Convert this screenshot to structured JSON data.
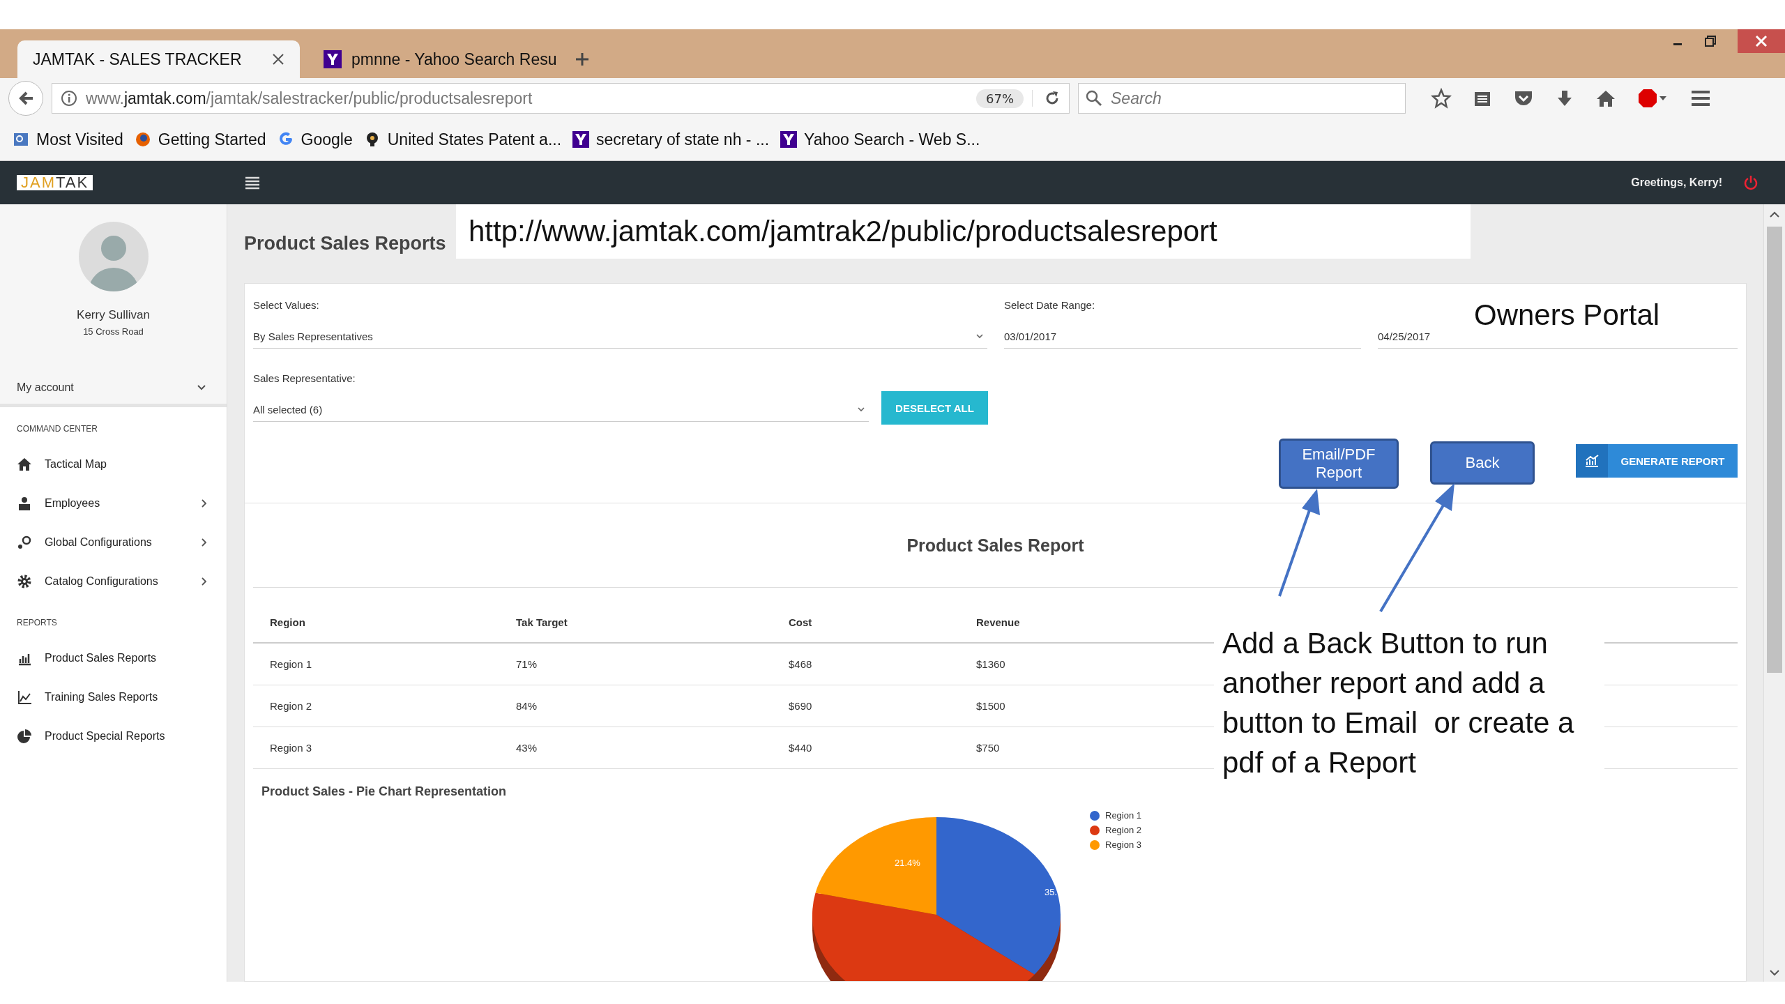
{
  "browser": {
    "tabs": [
      {
        "title": "JAMTAK - SALES TRACKER",
        "selected": true,
        "kind": "site"
      },
      {
        "title": "pmnne - Yahoo Search Resu",
        "selected": false,
        "kind": "yahoo"
      }
    ],
    "address": {
      "prefix": "www.",
      "domain": "jamtak.com",
      "path": "/jamtak/salestracker/public/productsalesreport"
    },
    "zoom": "67%",
    "search": {
      "placeholder": "Search"
    },
    "bookmarks": [
      {
        "label": "Most Visited",
        "kind": "folder"
      },
      {
        "label": "Getting Started",
        "kind": "firefox"
      },
      {
        "label": "Google",
        "kind": "google"
      },
      {
        "label": "United States Patent a...",
        "kind": "bulb"
      },
      {
        "label": "secretary of state nh - ...",
        "kind": "yahoo"
      },
      {
        "label": "Yahoo Search - Web S...",
        "kind": "yahoo"
      }
    ]
  },
  "app": {
    "logo": {
      "first": "JAM",
      "second": "TAK"
    },
    "greeting": "Greetings, Kerry!"
  },
  "sidebar": {
    "user": {
      "name": "Kerry Sullivan",
      "address": "15 Cross Road"
    },
    "account": "My account",
    "sections": [
      {
        "heading": "COMMAND CENTER",
        "items": [
          {
            "label": "Tactical Map",
            "kind": "home",
            "has_submenu": false
          },
          {
            "label": "Employees",
            "kind": "person",
            "has_submenu": true
          },
          {
            "label": "Global Configurations",
            "kind": "keys",
            "has_submenu": true
          },
          {
            "label": "Catalog Configurations",
            "kind": "gear",
            "has_submenu": true
          }
        ]
      },
      {
        "heading": "REPORTS",
        "items": [
          {
            "label": "Product Sales Reports",
            "kind": "bars",
            "has_submenu": false
          },
          {
            "label": "Training Sales Reports",
            "kind": "line",
            "has_submenu": false
          },
          {
            "label": "Product Special Reports",
            "kind": "pie",
            "has_submenu": false
          }
        ]
      }
    ]
  },
  "page": {
    "title": "Product Sales Reports",
    "form": {
      "values_label": "Select Values:",
      "values": "By Sales Representatives",
      "date_label": "Select Date Range:",
      "date_from": "03/01/2017",
      "date_to": "04/25/2017",
      "rep_label": "Sales Representative:",
      "rep": "All selected (6)",
      "deselect": "DESELECT ALL",
      "generate": "GENERATE REPORT"
    },
    "report": {
      "title": "Product Sales Report",
      "table": {
        "columns": [
          "Region",
          "Tak Target",
          "Cost",
          "Revenue"
        ],
        "rows": [
          [
            "Region 1",
            "71%",
            "$468",
            "$1360"
          ],
          [
            "Region 2",
            "84%",
            "$690",
            "$1500"
          ],
          [
            "Region 3",
            "43%",
            "$440",
            "$750"
          ]
        ]
      },
      "chart": {
        "title": "Product Sales - Pie Chart Representation",
        "slice_labels": [
          "35.",
          "21.4%"
        ],
        "legend": [
          {
            "label": "Region 1",
            "color": "#3366cc"
          },
          {
            "label": "Region 2",
            "color": "#dc3912"
          },
          {
            "label": "Region 3",
            "color": "#ff9900"
          }
        ]
      }
    }
  },
  "annotations": {
    "url": "http://www.jamtak.com/jamtrak2/public/productsalesreport",
    "portal": "Owners Portal",
    "buttons": [
      {
        "label": "Email/PDF Report"
      },
      {
        "label": "Back"
      }
    ],
    "note": "Add a Back Button to run another report and add a button to Email  or create a pdf of a Report"
  }
}
